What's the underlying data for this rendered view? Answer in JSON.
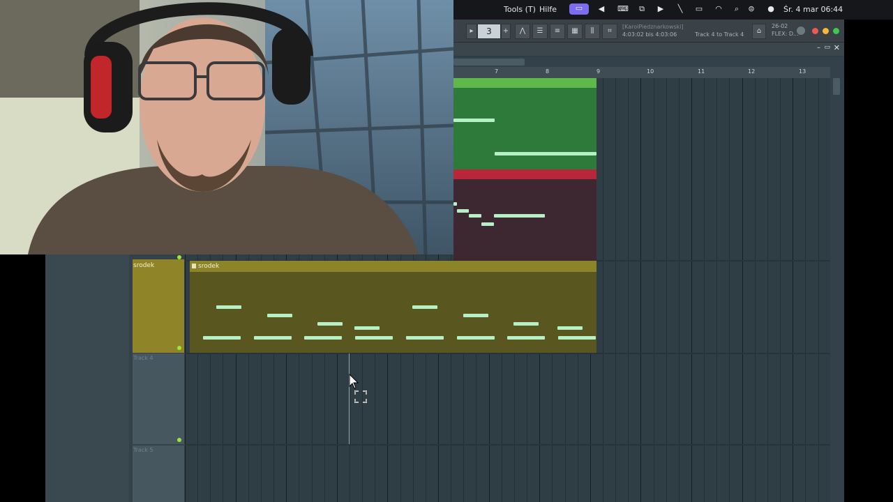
{
  "menubar": {
    "tools": "Tools (T)",
    "help": "Hilfe",
    "datetime": "Śr. 4 mar  06:44"
  },
  "toolbar": {
    "pattern_number": "3",
    "song_title": "[KarolPiedznarkowski]",
    "time_range": "4:03:02 bis 4:03:06",
    "hint": "Track 4 to Track 4",
    "cpu_label": "26-02",
    "plugin_label": "FLEX: D..."
  },
  "ruler": {
    "marks": [
      "7",
      "8",
      "9",
      "10",
      "11",
      "12",
      "13"
    ]
  },
  "tracks": {
    "srodek_label": "srodek",
    "srodek_clip_label": "srodek",
    "track4_label": "Track 4",
    "track5_label": "Track 5"
  },
  "colors": {
    "green_clip": "#2e7a3a",
    "red_clip": "#4a2a33",
    "olive_clip": "#6b6622",
    "note": "#b7f0c7"
  }
}
